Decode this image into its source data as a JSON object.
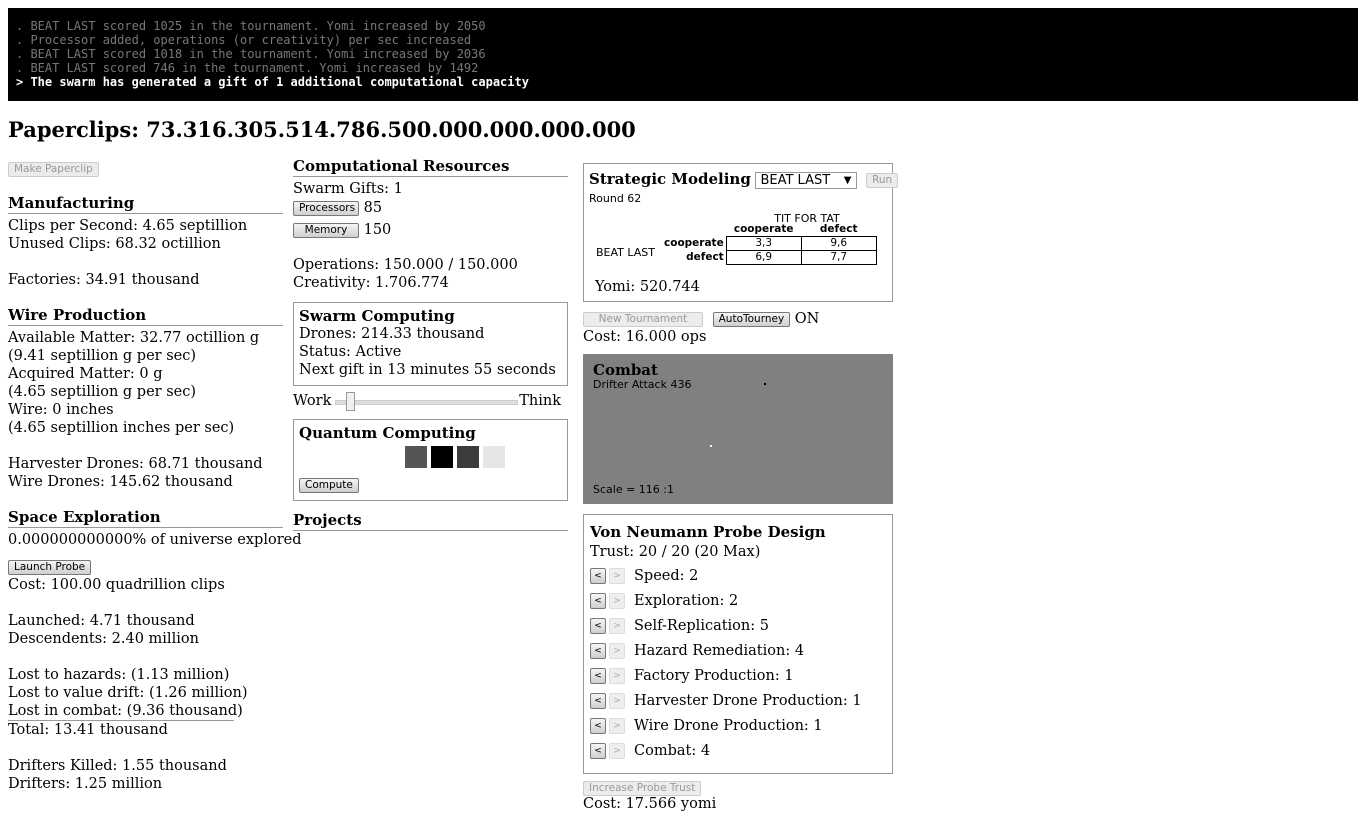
{
  "console": {
    "lines": [
      ". BEAT LAST scored 1025 in the tournament. Yomi increased by 2050",
      ". Processor added, operations (or creativity) per sec increased",
      ". BEAT LAST scored 1018 in the tournament. Yomi increased by 2036",
      ". BEAT LAST scored 746 in the tournament. Yomi increased by 1492",
      "> The swarm has generated a gift of 1 additional computational capacity"
    ]
  },
  "title": "Paperclips: 73.316.305.514.786.500.000.000.000.000",
  "left": {
    "make_paperclip": "Make Paperclip",
    "manufacturing": {
      "heading": "Manufacturing",
      "clips_per_second": "Clips per Second: 4.65 septillion",
      "unused_clips": "Unused Clips: 68.32 octillion",
      "factories": "Factories: 34.91 thousand"
    },
    "wire": {
      "heading": "Wire Production",
      "available": "Available Matter: 32.77 octillion g",
      "available_rate": "(9.41 septillion g per sec)",
      "acquired": "Acquired Matter: 0 g",
      "acquired_rate": "(4.65 septillion g per sec)",
      "wire": "Wire: 0 inches",
      "wire_rate": "(4.65 septillion inches per sec)",
      "harvester": "Harvester Drones: 68.71 thousand",
      "wire_drones": "Wire Drones: 145.62 thousand"
    },
    "space": {
      "heading": "Space Exploration",
      "explored": "0.000000000000% of universe explored",
      "launch": "Launch Probe",
      "cost": "Cost: 100.00 quadrillion clips",
      "launched": "Launched: 4.71 thousand",
      "descendents": "Descendents: 2.40 million",
      "hazards": "Lost to hazards: (1.13 million)",
      "drift": "Lost to value drift: (1.26 million)",
      "combat": "Lost in combat: (9.36 thousand)",
      "total": "Total: 13.41 thousand",
      "drifters_killed": "Drifters Killed: 1.55 thousand",
      "drifters": "Drifters: 1.25 million"
    }
  },
  "middle": {
    "comp_heading": "Computational Resources",
    "swarm_gifts": "Swarm Gifts: 1",
    "processors_label": "Processors",
    "processors_value": "85",
    "memory_label": "Memory",
    "memory_value": "150",
    "operations": "Operations: 150.000 / 150.000",
    "creativity": "Creativity: 1.706.774",
    "swarm": {
      "heading": "Swarm Computing",
      "drones": "Drones: 214.33 thousand",
      "status": "Status: Active",
      "next_gift": "Next gift in 13 minutes 55 seconds"
    },
    "slider": {
      "left": "Work",
      "right": "Think",
      "value": 0.08
    },
    "quantum": {
      "heading": "Quantum Computing",
      "chip_colors": [
        "#555555",
        "#000000",
        "#3c3c3c",
        "#e6e6e6"
      ],
      "compute": "Compute"
    },
    "projects_heading": "Projects"
  },
  "right": {
    "strategic": {
      "heading": "Strategic Modeling",
      "strategy": "BEAT LAST",
      "run": "Run",
      "round": "Round 62",
      "opponent": "TIT FOR TAT",
      "col_a": "cooperate",
      "col_b": "defect",
      "player": "BEAT LAST",
      "row_a": "cooperate",
      "row_b": "defect",
      "cells": [
        [
          "3,3",
          "9,6"
        ],
        [
          "6,9",
          "7,7"
        ]
      ],
      "yomi": "Yomi: 520.744"
    },
    "new_tournament": "New Tournament",
    "autotourney": "AutoTourney",
    "autotourney_state": "ON",
    "tourney_cost": "Cost: 16.000 ops",
    "combat": {
      "heading": "Combat",
      "drifter": "Drifter Attack 436",
      "scale": "Scale = 116 :1"
    },
    "probe": {
      "heading": "Von Neumann Probe Design",
      "trust": "Trust: 20 / 20 (20 Max)",
      "minus": "<",
      "plus": ">",
      "stats": [
        "Speed: 2",
        "Exploration: 2",
        "Self-Replication: 5",
        "Hazard Remediation: 4",
        "Factory Production: 1",
        "Harvester Drone Production: 1",
        "Wire Drone Production: 1",
        "Combat: 4"
      ]
    },
    "increase_trust": "Increase Probe Trust",
    "trust_cost": "Cost: 17.566 yomi"
  }
}
